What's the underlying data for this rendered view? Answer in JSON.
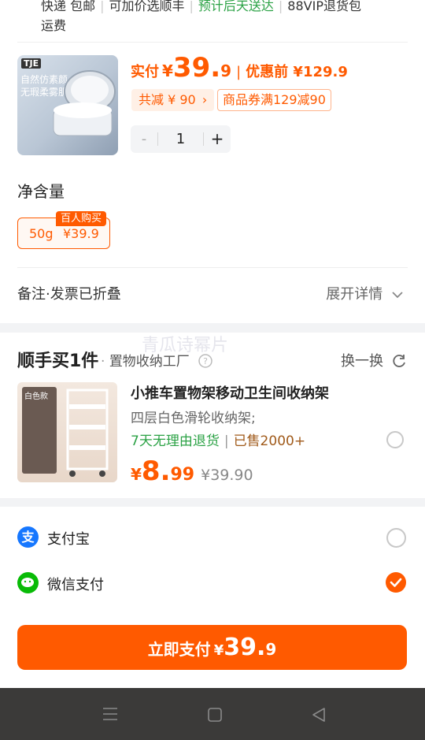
{
  "top_tags": {
    "items": [
      "快递 包邮",
      "可加价选顺丰",
      "预计后天送达",
      "88VIP退货包"
    ],
    "line2": "运费"
  },
  "product": {
    "brand": "TJE",
    "image_text1": "自然仿素颜",
    "image_text2": "无瑕柔雾肌",
    "price_label": "实付",
    "currency": "¥",
    "price_int": "39.",
    "price_dec": "9",
    "pre_label": "优惠前 ¥129.9",
    "discount_tag": "共减 ¥ 90",
    "coupon_tag": "商品券满129减90",
    "quantity": "1",
    "minus": "-",
    "plus": "+"
  },
  "spec": {
    "title": "净含量",
    "option_label": "50g",
    "option_price": "¥39.9",
    "badge": "百人购买"
  },
  "remark": {
    "label": "备注·发票已折叠",
    "expand": "展开详情"
  },
  "watermark": "青瓜诗幂片",
  "addon": {
    "title": "顺手买1件",
    "subtitle": "置物收纳工厂",
    "swap": "换一换",
    "product": {
      "image_tag": "白色款",
      "name": "小推车置物架移动卫生间收纳架",
      "desc": "四层白色滑轮收纳架;",
      "tag_green": "7天无理由退货",
      "tag_sold": "已售2000+",
      "currency": "¥",
      "price_int": "8.",
      "price_dec": "99",
      "orig_price": "¥39.90"
    }
  },
  "payment": {
    "alipay": "支付宝",
    "wechat": "微信支付",
    "selected": "wechat"
  },
  "pay_button": {
    "label": "立即支付",
    "currency": "¥",
    "price_int": "39.",
    "price_dec": "9"
  },
  "colors": {
    "accent": "#ff5a00",
    "green": "#2ba245",
    "navbar": "#3b3a39"
  }
}
